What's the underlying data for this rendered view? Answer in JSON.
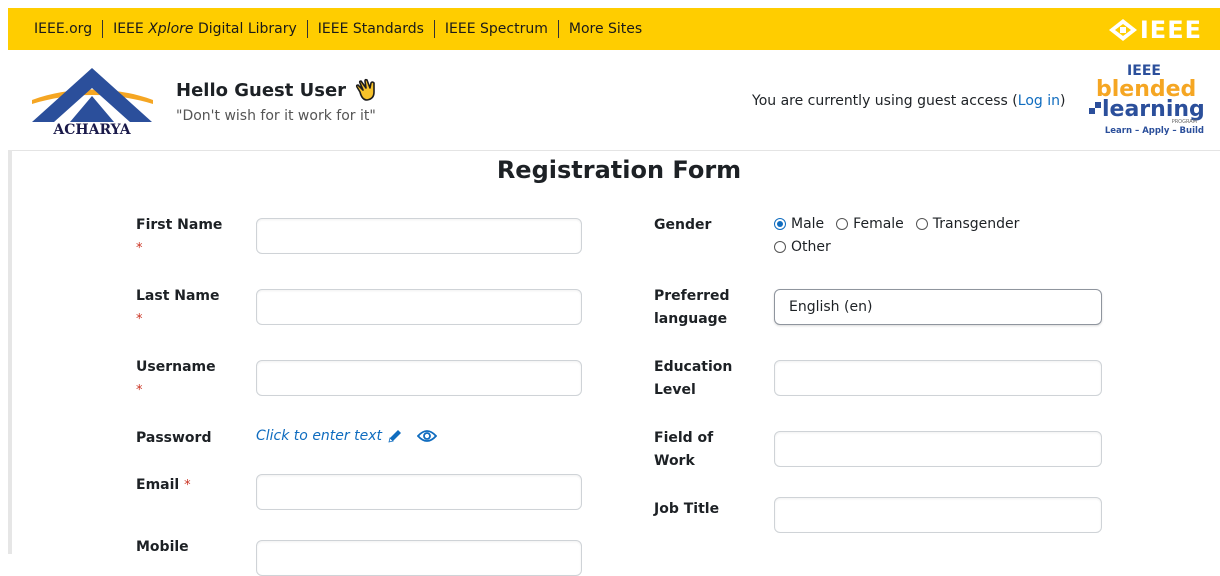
{
  "topbar": {
    "links": [
      {
        "label": "IEEE.org"
      },
      {
        "label_pre": "IEEE ",
        "label_em": "Xplore",
        "label_post": " Digital Library"
      },
      {
        "label": "IEEE Standards"
      },
      {
        "label": "IEEE Spectrum"
      },
      {
        "label": "More Sites"
      }
    ],
    "logo_text": "IEEE",
    "color": "#ffcd00"
  },
  "header": {
    "org_logo_text": "ACHARYA",
    "greeting": "Hello Guest User",
    "quote": "\"Don't wish for it work for it\"",
    "guest_prefix": "You are currently using guest access (",
    "login_label": "Log in",
    "guest_suffix": ")",
    "blended": {
      "line1": "IEEE",
      "line2": "blended",
      "line3": "learning",
      "line4": "PROGRAM",
      "tagline": "Learn – Apply – Build"
    }
  },
  "form": {
    "title": "Registration Form",
    "required_mark": "*",
    "fields": {
      "first_name": {
        "label_1": "First Name",
        "value": ""
      },
      "last_name": {
        "label_1": "Last Name",
        "value": ""
      },
      "username": {
        "label_1": "Username",
        "value": ""
      },
      "password": {
        "label_1": "Password",
        "placeholder": "Click to enter text"
      },
      "email": {
        "label_1": "Email",
        "value": ""
      },
      "mobile": {
        "label_1": "Mobile",
        "value": ""
      },
      "gender": {
        "label_1": "Gender",
        "options": [
          "Male",
          "Female",
          "Transgender",
          "Other"
        ],
        "selected": "Male"
      },
      "preferred_language": {
        "label_1": "Preferred",
        "label_2": "language",
        "value": "English (en)"
      },
      "education_level": {
        "label_1": "Education",
        "label_2": "Level",
        "value": ""
      },
      "field_of_work": {
        "label_1": "Field of",
        "label_2": "Work",
        "value": ""
      },
      "job_title": {
        "label_1": "Job Title",
        "value": ""
      }
    }
  },
  "colors": {
    "link": "#0f6cbf",
    "required": "#ca3120",
    "brand_orange": "#f5a623",
    "brand_blue": "#2b4f9b"
  }
}
